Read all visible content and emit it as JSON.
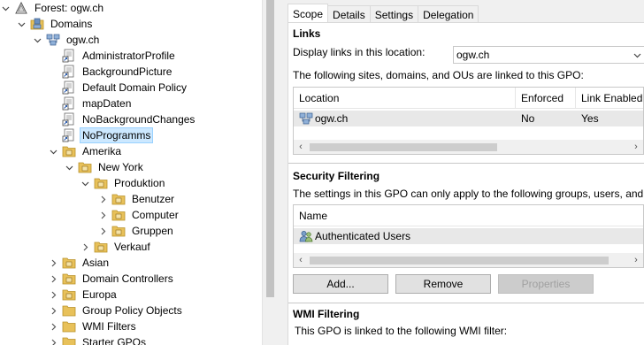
{
  "tree": {
    "forest": "Forest: ogw.ch",
    "domains": "Domains",
    "domain": "ogw.ch",
    "gpo_links": [
      "AdministratorProfile",
      "BackgroundPicture",
      "Default Domain Policy",
      "mapDaten",
      "NoBackgroundChanges",
      "NoProgramms"
    ],
    "ou_amerika": "Amerika",
    "ou_newyork": "New York",
    "ou_produktion": "Produktion",
    "ou_benutzer": "Benutzer",
    "ou_computer": "Computer",
    "ou_gruppen": "Gruppen",
    "ou_verkauf": "Verkauf",
    "ou_asian": "Asian",
    "domain_controllers": "Domain Controllers",
    "ou_europa": "Europa",
    "gpo_container": "Group Policy Objects",
    "wmi_filters": "WMI Filters",
    "starter_gpos": "Starter GPOs"
  },
  "tabs": [
    "Scope",
    "Details",
    "Settings",
    "Delegation"
  ],
  "links": {
    "title": "Links",
    "display_label": "Display links in this location:",
    "location_value": "ogw.ch",
    "description": "The following sites, domains, and OUs are linked to this GPO:",
    "columns": [
      "Location",
      "Enforced",
      "Link Enabled"
    ],
    "rows": [
      {
        "location": "ogw.ch",
        "enforced": "No",
        "link_enabled": "Yes"
      }
    ]
  },
  "security": {
    "title": "Security Filtering",
    "description": "The settings in this GPO can only apply to the following groups, users, and computer",
    "column": "Name",
    "rows": [
      "Authenticated Users"
    ],
    "add_label": "Add...",
    "remove_label": "Remove",
    "properties_label": "Properties"
  },
  "wmi": {
    "title": "WMI Filtering",
    "description": "This GPO is linked to the following WMI filter:"
  },
  "colors": {
    "selection": "#cce8ff",
    "folder": "#e8c15a",
    "row_highlight": "#e8e8e8"
  }
}
